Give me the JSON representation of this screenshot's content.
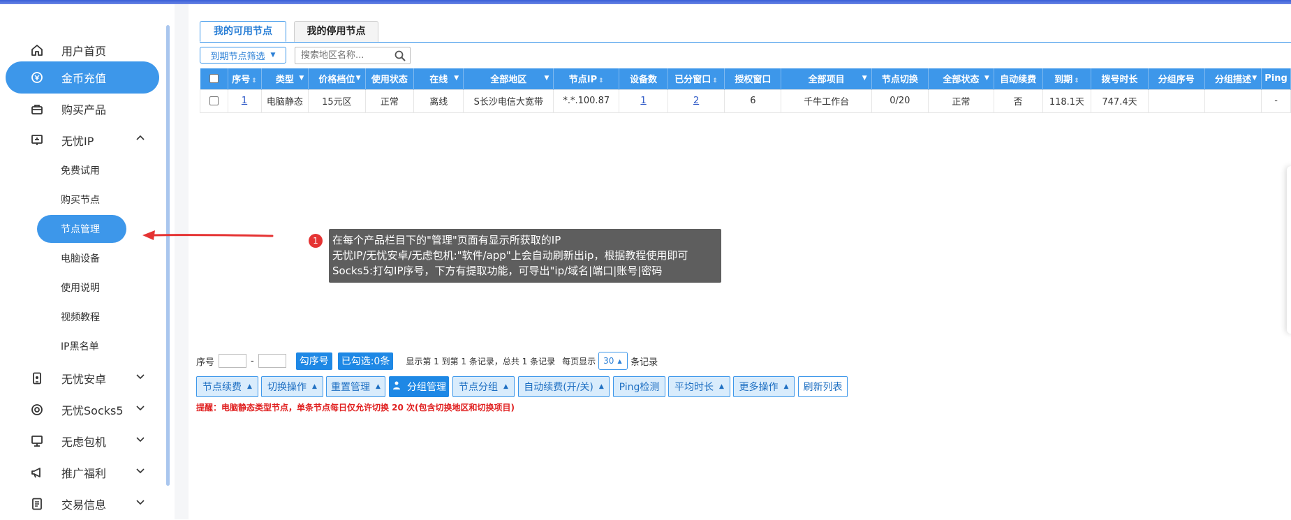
{
  "sidebar": {
    "items": [
      {
        "label": "用户首页",
        "icon": "home-icon",
        "active": false
      },
      {
        "label": "金币充值",
        "icon": "coin-icon",
        "active": true
      },
      {
        "label": "购买产品",
        "icon": "bag-icon",
        "active": false
      },
      {
        "label": "无忧IP",
        "icon": "monitor-icon",
        "expanded": true
      },
      {
        "label": "无忧安卓",
        "icon": "phone-icon"
      },
      {
        "label": "无忧Socks5",
        "icon": "target-icon"
      },
      {
        "label": "无虑包机",
        "icon": "desktop-icon"
      },
      {
        "label": "推广福利",
        "icon": "megaphone-icon"
      },
      {
        "label": "交易信息",
        "icon": "document-icon"
      }
    ],
    "sub_items": [
      "免费试用",
      "购买节点",
      "节点管理",
      "电脑设备",
      "使用说明",
      "视频教程",
      "IP黑名单"
    ],
    "active_sub": "节点管理"
  },
  "tabs": [
    "我的可用节点",
    "我的停用节点"
  ],
  "filter": {
    "label": "到期节点筛选"
  },
  "search": {
    "placeholder": "搜索地区名称..."
  },
  "table": {
    "columns": [
      "序号",
      "类型",
      "价格档位",
      "使用状态",
      "在线",
      "全部地区",
      "节点IP",
      "设备数",
      "已分窗口",
      "授权窗口",
      "全部项目",
      "节点切换",
      "全部状态",
      "自动续费",
      "到期",
      "拨号时长",
      "分组序号",
      "分组描述",
      "Ping"
    ],
    "rows": [
      {
        "seq": "1",
        "type": "电脑静态",
        "price": "15元区",
        "use_status": "正常",
        "online": "离线",
        "region": "S长沙电信大宽带",
        "ip": "*.*.100.87",
        "devices": "1",
        "windows": "2",
        "auth": "6",
        "project": "千牛工作台",
        "switch": "0/20",
        "status": "正常",
        "renew": "否",
        "expire": "118.1天",
        "dial": "747.4天",
        "group_seq": "",
        "group_desc": "",
        "ping": "-"
      }
    ]
  },
  "annotation": {
    "badge": "1",
    "lines": [
      "在每个产品栏目下的\"管理\"页面有显示所获取的IP",
      "无忧IP/无忧安卓/无虑包机:\"软件/app\"上会自动刷新出ip，根据教程使用即可",
      "Socks5:打勾IP序号，下方有提取功能，可导出\"ip/域名|端口|账号|密码"
    ]
  },
  "pager": {
    "seq_label": "序号",
    "dash": "-",
    "check_btn": "勾序号",
    "checked_btn": "已勾选:0条",
    "info": "显示第 1 到第 1 条记录，总共 1 条记录",
    "per_page_label": "每页显示",
    "per_page": "30",
    "unit": "条记录"
  },
  "actions": [
    "节点续费",
    "切换操作",
    "重置管理",
    "分组管理",
    "节点分组",
    "自动续费(开/关)",
    "Ping检测",
    "平均时长",
    "更多操作",
    "刷新列表"
  ],
  "notice": "提醒：电脑静态类型节点，单条节点每日仅允许切换 20 次(包含切换地区和切换项目)",
  "colors": {
    "accent": "#3d97ea",
    "primary_btn": "#1e88e5",
    "ok": "#1a9a1a",
    "bad": "#e33333"
  }
}
